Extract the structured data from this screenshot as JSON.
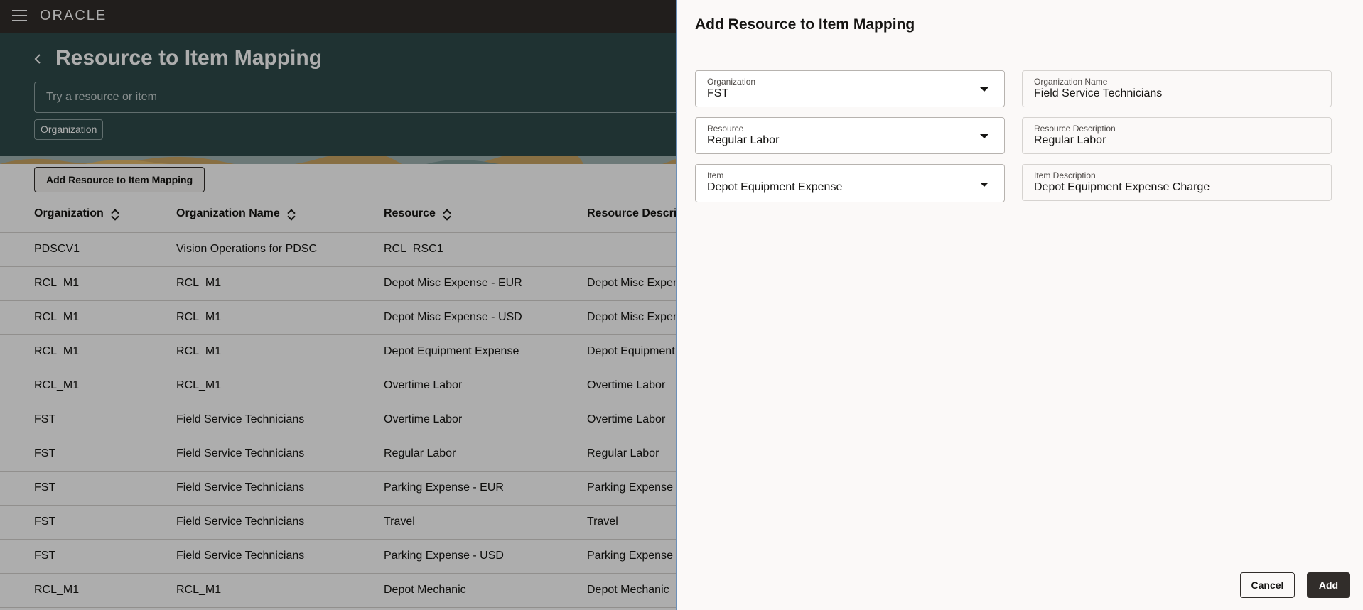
{
  "app": {
    "logo": "ORACLE"
  },
  "page": {
    "title": "Resource to Item Mapping",
    "search_placeholder": "Try a resource or item",
    "filter_chip": "Organization",
    "add_button": "Add Resource to Item Mapping"
  },
  "table": {
    "columns": [
      "Organization",
      "Organization Name",
      "Resource",
      "Resource Description"
    ],
    "rows": [
      [
        "PDSCV1",
        "Vision Operations for PDSC",
        "RCL_RSC1",
        ""
      ],
      [
        "RCL_M1",
        "RCL_M1",
        "Depot Misc Expense - EUR",
        "Depot Misc Expense - EUR"
      ],
      [
        "RCL_M1",
        "RCL_M1",
        "Depot Misc Expense - USD",
        "Depot Misc Expense - USD"
      ],
      [
        "RCL_M1",
        "RCL_M1",
        "Depot Equipment Expense",
        "Depot Equipment Expense"
      ],
      [
        "RCL_M1",
        "RCL_M1",
        "Overtime Labor",
        "Overtime Labor"
      ],
      [
        "FST",
        "Field Service Technicians",
        "Overtime Labor",
        "Overtime Labor"
      ],
      [
        "FST",
        "Field Service Technicians",
        "Regular Labor",
        "Regular Labor"
      ],
      [
        "FST",
        "Field Service Technicians",
        "Parking Expense - EUR",
        "Parking Expense - EUR"
      ],
      [
        "FST",
        "Field Service Technicians",
        "Travel",
        "Travel"
      ],
      [
        "FST",
        "Field Service Technicians",
        "Parking Expense - USD",
        "Parking Expense - USD"
      ],
      [
        "RCL_M1",
        "RCL_M1",
        "Depot Mechanic",
        "Depot Mechanic"
      ]
    ]
  },
  "drawer": {
    "title": "Add Resource to Item Mapping",
    "organization": {
      "label": "Organization",
      "value": "FST"
    },
    "organization_name": {
      "label": "Organization Name",
      "value": "Field Service Technicians"
    },
    "resource": {
      "label": "Resource",
      "value": "Regular Labor"
    },
    "resource_description": {
      "label": "Resource Description",
      "value": "Regular Labor"
    },
    "item": {
      "label": "Item",
      "value": "Depot Equipment Expense"
    },
    "item_description": {
      "label": "Item Description",
      "value": "Depot Equipment Expense Charge"
    },
    "cancel_label": "Cancel",
    "add_label": "Add"
  },
  "colors": {
    "header": "#312d2a",
    "hero": "#2f4a4a",
    "primary_button": "#312d2a"
  }
}
